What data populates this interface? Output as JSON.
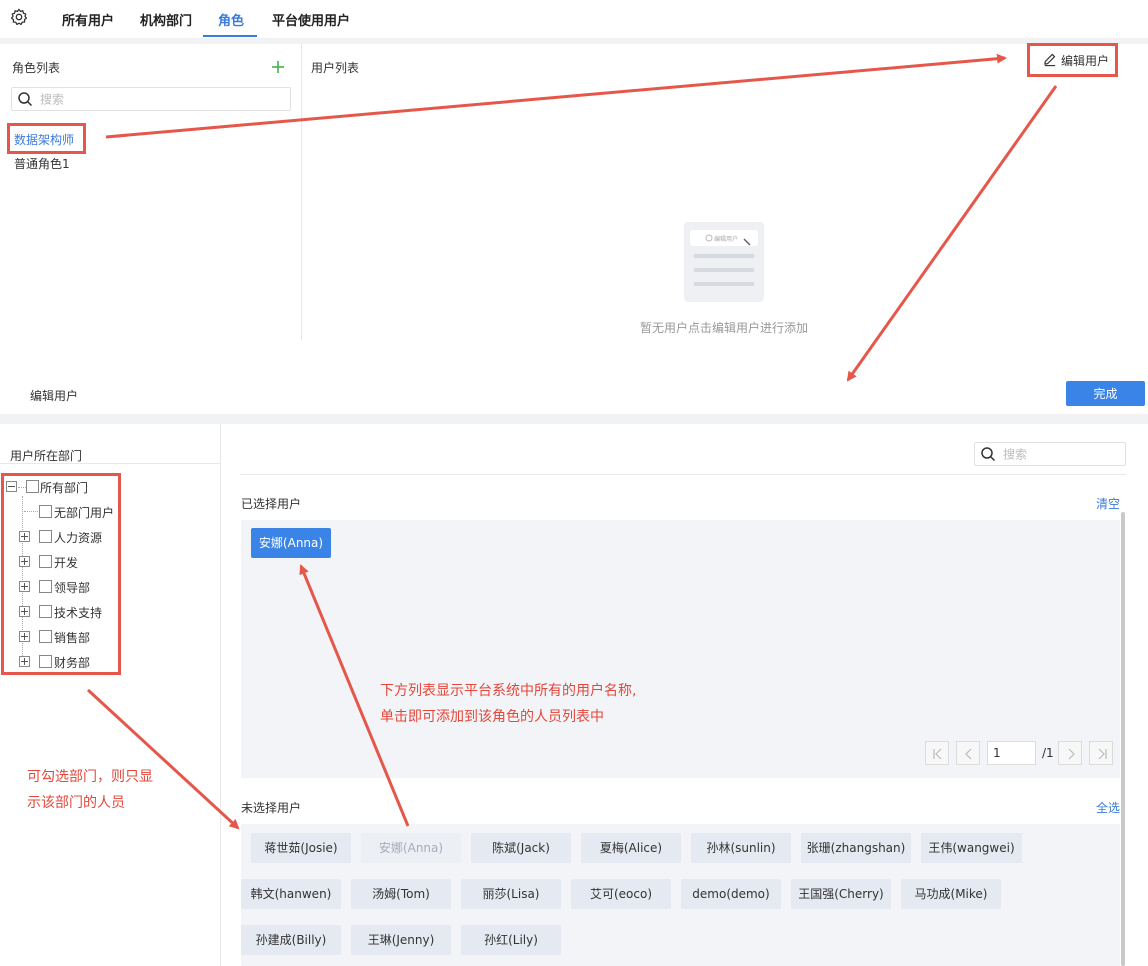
{
  "tabs": [
    {
      "label": "所有用户"
    },
    {
      "label": "机构部门"
    },
    {
      "label": "角色"
    },
    {
      "label": "平台使用用户"
    }
  ],
  "roles_pane": {
    "title": "角色列表",
    "search_placeholder": "搜索",
    "roles": [
      {
        "label": "数据架构师"
      },
      {
        "label": "普通角色1"
      }
    ]
  },
  "users_pane": {
    "title": "用户列表",
    "edit_button": "编辑用户",
    "empty_text": "暂无用户点击编辑用户进行添加",
    "illustration_label": "编辑用户"
  },
  "edit_section": {
    "title": "编辑用户",
    "done_button": "完成",
    "dept_title": "用户所在部门",
    "search_placeholder": "搜索",
    "tree": [
      {
        "label": "所有部门"
      },
      {
        "label": "无部门用户"
      },
      {
        "label": "人力资源"
      },
      {
        "label": "开发"
      },
      {
        "label": "领导部"
      },
      {
        "label": "技术支持"
      },
      {
        "label": "销售部"
      },
      {
        "label": "财务部"
      }
    ],
    "selected_title": "已选择用户",
    "clear_link": "清空",
    "selected_users": [
      {
        "label": "安娜(Anna)"
      }
    ],
    "pager": {
      "page": "1",
      "total": "/1"
    },
    "unselected_title": "未选择用户",
    "select_all_link": "全选",
    "unselected_users": [
      {
        "label": "蒋世茹(Josie)"
      },
      {
        "label": "安娜(Anna)"
      },
      {
        "label": "陈斌(Jack)"
      },
      {
        "label": "夏梅(Alice)"
      },
      {
        "label": "孙林(sunlin)"
      },
      {
        "label": "张珊(zhangshan)"
      },
      {
        "label": "王伟(wangwei)"
      },
      {
        "label": "韩文(hanwen)"
      },
      {
        "label": "汤姆(Tom)"
      },
      {
        "label": "丽莎(Lisa)"
      },
      {
        "label": "艾可(eoco)"
      },
      {
        "label": "demo(demo)"
      },
      {
        "label": "王国强(Cherry)"
      },
      {
        "label": "马功成(Mike)"
      },
      {
        "label": "孙建成(Billy)"
      },
      {
        "label": "王琳(Jenny)"
      },
      {
        "label": "孙红(Lily)"
      }
    ]
  },
  "annotations": {
    "note_center": [
      "下方列表显示平台系统中所有的用户名称,",
      "单击即可添加到该角色的人员列表中"
    ],
    "note_left": [
      "可勾选部门，则只显",
      "示该部门的人员"
    ]
  },
  "colors": {
    "accent": "#3a7bdc",
    "annotation": "#e5574a"
  }
}
